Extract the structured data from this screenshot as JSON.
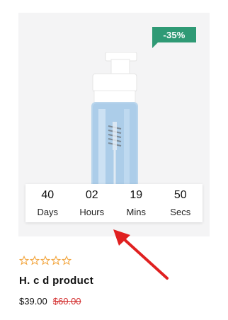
{
  "product": {
    "discount_badge": "-35%",
    "countdown": [
      {
        "value": "40",
        "label": "Days"
      },
      {
        "value": "02",
        "label": "Hours"
      },
      {
        "value": "19",
        "label": "Mins"
      },
      {
        "value": "50",
        "label": "Secs"
      }
    ],
    "rating": {
      "stars_filled": 0,
      "stars_total": 5
    },
    "title": "H. c d product",
    "price": "$39.00",
    "old_price": "$60.00"
  },
  "colors": {
    "badge": "#2f9a75",
    "star_outline": "#f2a33a",
    "old_price": "#d32f2f",
    "arrow": "#e02020"
  },
  "icons": [
    "product-bottle-image",
    "star-outline-icon",
    "red-arrow-annotation"
  ]
}
